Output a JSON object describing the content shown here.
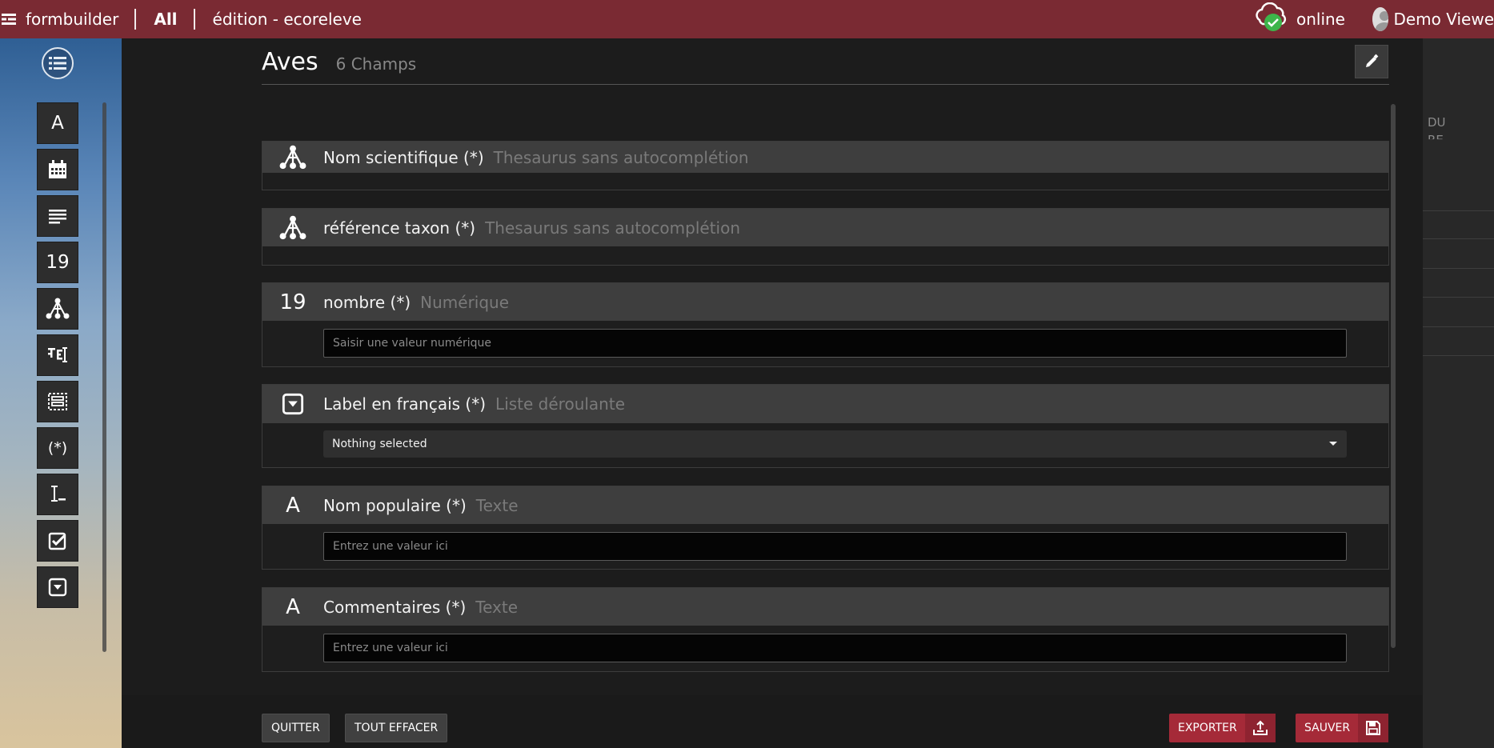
{
  "topbar": {
    "app_name": "formbuilder",
    "filter": "All",
    "context": "édition - ecoreleve",
    "status": "online",
    "user": "Demo Viewe"
  },
  "colors": {
    "header_bg": "#7a2a33",
    "accent_red": "#a52a38",
    "online_green": "#3db54a"
  },
  "sidebar": {
    "tools": [
      {
        "icon": "text-icon",
        "glyph": "A"
      },
      {
        "icon": "calendar-icon",
        "glyph": ""
      },
      {
        "icon": "textarea-icon",
        "glyph": ""
      },
      {
        "icon": "number-icon",
        "glyph": "19"
      },
      {
        "icon": "thesaurus-icon",
        "glyph": ""
      },
      {
        "icon": "autocomplete-icon",
        "glyph": ""
      },
      {
        "icon": "subform-icon",
        "glyph": ""
      },
      {
        "icon": "pattern-icon",
        "glyph": "(*)"
      },
      {
        "icon": "text-cursor-icon",
        "glyph": ""
      },
      {
        "icon": "checkbox-icon",
        "glyph": ""
      },
      {
        "icon": "dropdown-icon",
        "glyph": ""
      }
    ]
  },
  "form": {
    "title": "Aves",
    "count": "6 Champs",
    "fields": [
      {
        "name": "Nom scientifique (*)",
        "type": "Thesaurus sans autocomplétion",
        "icon": "thesaurus-icon"
      },
      {
        "name": "référence taxon (*)",
        "type": "Thesaurus sans autocomplétion",
        "icon": "thesaurus-icon"
      },
      {
        "name": "nombre (*)",
        "type": "Numérique",
        "icon": "number-icon",
        "icon_text": "19",
        "placeholder": "Saisir une valeur numérique"
      },
      {
        "name": "Label en français (*)",
        "type": "Liste déroulante",
        "icon": "dropdown-icon",
        "selected": "Nothing selected"
      },
      {
        "name": "Nom populaire (*)",
        "type": "Texte",
        "icon": "text-icon",
        "icon_text": "A",
        "placeholder": "Entrez une valeur ici"
      },
      {
        "name": "Commentaires (*)",
        "type": "Texte",
        "icon": "text-icon",
        "icon_text": "A",
        "placeholder": "Entrez une valeur ici"
      }
    ]
  },
  "right_panel": {
    "fragment_1": "DU",
    "fragment_2": "RE"
  },
  "buttons": {
    "quit": "QUITTER",
    "clear_all": "TOUT EFFACER",
    "export": "EXPORTER",
    "save": "SAUVER"
  }
}
